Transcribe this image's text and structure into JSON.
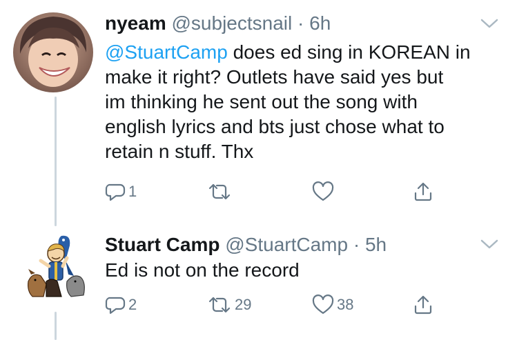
{
  "tweets": [
    {
      "display_name": "nyeam",
      "handle": "@subjectsnail",
      "separator": "·",
      "time": "6h",
      "mention": "@StuartCamp",
      "text_line1_rest": " does ed sing in KOREAN in",
      "text_line2": "make it right? Outlets have said yes but",
      "text_line3": "im thinking he sent out the song with",
      "text_line4": "english lyrics and bts just chose what to",
      "text_line5": "retain n stuff. Thx",
      "replies": "1",
      "retweets": "",
      "likes": ""
    },
    {
      "display_name": "Stuart Camp",
      "handle": "@StuartCamp",
      "separator": "·",
      "time": "5h",
      "text": "Ed is not on the record",
      "replies": "2",
      "retweets": "29",
      "likes": "38"
    }
  ],
  "icons": {
    "reply": "reply-icon",
    "retweet": "retweet-icon",
    "like": "heart-icon",
    "share": "share-icon",
    "menu": "chevron-down-icon"
  },
  "colors": {
    "text": "#14171a",
    "secondary": "#657786",
    "link": "#1da1f2",
    "thread_line": "#ccd6dd"
  }
}
